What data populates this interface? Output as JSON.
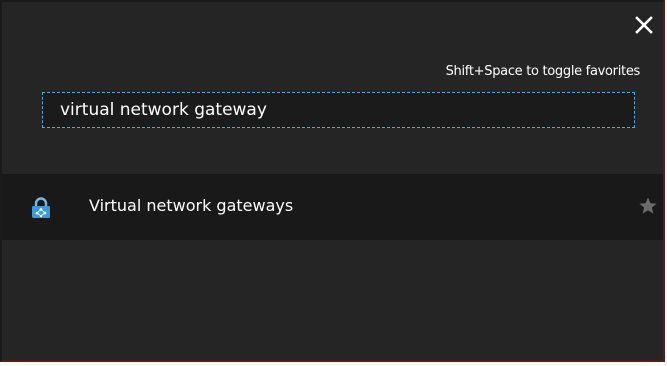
{
  "close": {
    "icon": "close-icon"
  },
  "hint": {
    "text": "Shift+Space to toggle favorites"
  },
  "search": {
    "value": "virtual network gateway"
  },
  "results": [
    {
      "label": "Virtual network gateways",
      "icon": "lock-network-icon",
      "favorite_icon": "star-icon",
      "favorited": false
    }
  ],
  "colors": {
    "panel_background": "#252526",
    "row_background": "#191919",
    "input_border": "#5aa8d8",
    "icon_blue": "#3a9bd8",
    "star_inactive": "#6b6b6b",
    "text": "#ffffff"
  }
}
